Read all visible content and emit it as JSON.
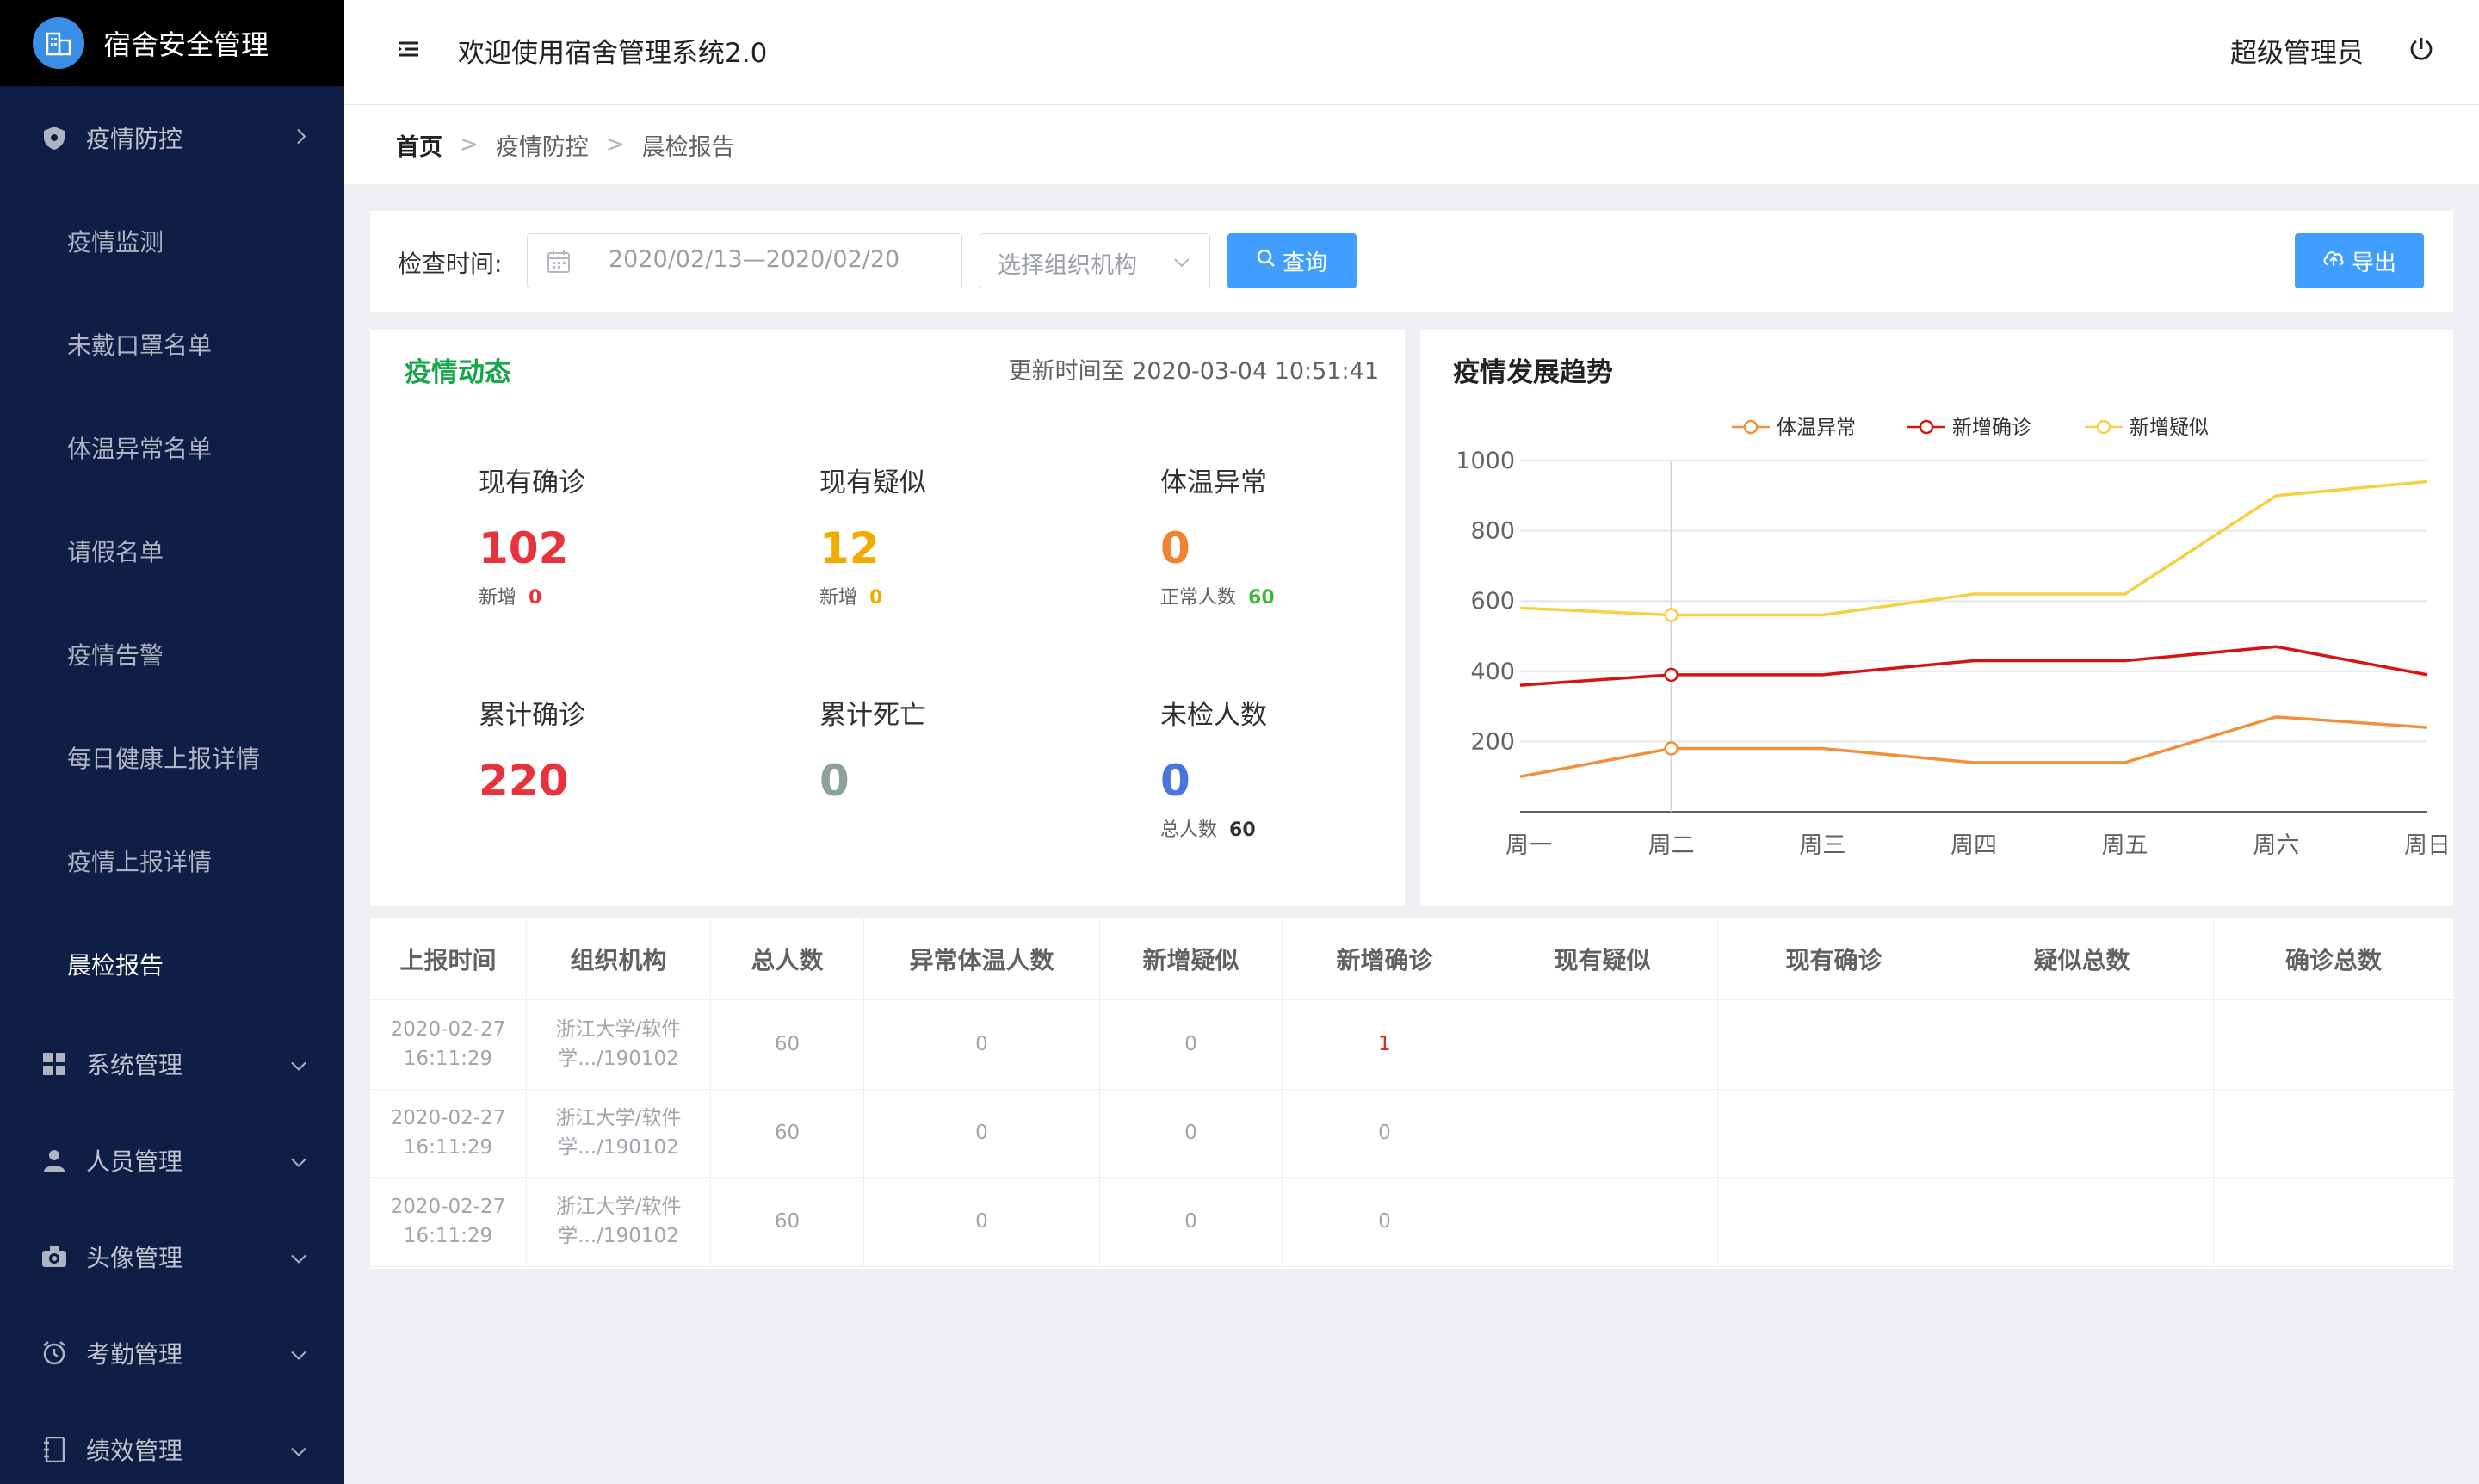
{
  "sidebar": {
    "logo_text": "宿舍安全管理",
    "groups": [
      {
        "label": "疫情防控",
        "icon": "shield-icon"
      },
      {
        "label": "系统管理",
        "icon": "grid-icon"
      },
      {
        "label": "人员管理",
        "icon": "user-icon"
      },
      {
        "label": "头像管理",
        "icon": "camera-icon"
      },
      {
        "label": "考勤管理",
        "icon": "alarm-icon"
      },
      {
        "label": "绩效管理",
        "icon": "notebook-icon"
      }
    ],
    "sub_items": [
      "疫情监测",
      "未戴口罩名单",
      "体温异常名单",
      "请假名单",
      "疫情告警",
      "每日健康上报详情",
      "疫情上报详情",
      "晨检报告"
    ],
    "active_sub": "晨检报告"
  },
  "header": {
    "title": "欢迎使用宿舍管理系统2.0",
    "user": "超级管理员"
  },
  "breadcrumb": [
    "首页",
    "疫情防控",
    "晨检报告"
  ],
  "filter": {
    "label": "检查时间:",
    "date_range": "2020/02/13—2020/02/20",
    "org_placeholder": "选择组织机构",
    "query_label": "查询",
    "export_label": "导出"
  },
  "stats": {
    "title": "疫情动态",
    "updated": "更新时间至 2020-03-04 10:51:41",
    "items": [
      {
        "label": "现有确诊",
        "value": "102",
        "sub_label": "新增",
        "sub_value": "0",
        "color": "#e8323c",
        "sub_color": "#e8323c"
      },
      {
        "label": "现有疑似",
        "value": "12",
        "sub_label": "新增",
        "sub_value": "0",
        "color": "#f0ad00",
        "sub_color": "#f0ad00"
      },
      {
        "label": "体温异常",
        "value": "0",
        "sub_label": "正常人数",
        "sub_value": "60",
        "color": "#f0842e",
        "sub_color": "#3cb832"
      },
      {
        "label": "累计确诊",
        "value": "220",
        "sub_label": "",
        "sub_value": "",
        "color": "#e8323c",
        "sub_color": "#e8323c"
      },
      {
        "label": "累计死亡",
        "value": "0",
        "sub_label": "",
        "sub_value": "",
        "color": "#8aa396",
        "sub_color": "#8aa396"
      },
      {
        "label": "未检人数",
        "value": "0",
        "sub_label": "总人数",
        "sub_value": "60",
        "color": "#4a74e0",
        "sub_color": "#303133"
      }
    ]
  },
  "chart_data": {
    "type": "line",
    "title": "疫情发展趋势",
    "categories": [
      "周一",
      "周二",
      "周三",
      "周四",
      "周五",
      "周六",
      "周日"
    ],
    "ylim": [
      0,
      1000
    ],
    "yticks": [
      200,
      400,
      600,
      800,
      1000
    ],
    "legend_position": "top",
    "grid": true,
    "series": [
      {
        "name": "体温异常",
        "color": "#f2903a",
        "values": [
          100,
          180,
          180,
          140,
          140,
          270,
          240
        ]
      },
      {
        "name": "新增确诊",
        "color": "#d61313",
        "values": [
          360,
          390,
          390,
          430,
          430,
          470,
          390
        ]
      },
      {
        "name": "新增疑似",
        "color": "#f5d041",
        "values": [
          580,
          560,
          560,
          620,
          620,
          900,
          940
        ]
      }
    ],
    "highlight_index": 1
  },
  "table": {
    "headers": [
      "上报时间",
      "组织机构",
      "总人数",
      "异常体温人数",
      "新增疑似",
      "新增确诊",
      "现有疑似",
      "现有确诊",
      "疑似总数",
      "确诊总数"
    ],
    "rows": [
      {
        "time": "2020-02-27 16:11:29",
        "org": "浙江大学/软件学.../190102",
        "total": "60",
        "abnormal": "0",
        "new_suspect": "0",
        "new_confirm": "1",
        "cur_suspect": "",
        "cur_confirm": "",
        "suspect_total": "",
        "confirm_total": ""
      },
      {
        "time": "2020-02-27 16:11:29",
        "org": "浙江大学/软件学.../190102",
        "total": "60",
        "abnormal": "0",
        "new_suspect": "0",
        "new_confirm": "0",
        "cur_suspect": "",
        "cur_confirm": "",
        "suspect_total": "",
        "confirm_total": ""
      },
      {
        "time": "2020-02-27 16:11:29",
        "org": "浙江大学/软件学.../190102",
        "total": "60",
        "abnormal": "0",
        "new_suspect": "0",
        "new_confirm": "0",
        "cur_suspect": "",
        "cur_confirm": "",
        "suspect_total": "",
        "confirm_total": ""
      }
    ]
  }
}
